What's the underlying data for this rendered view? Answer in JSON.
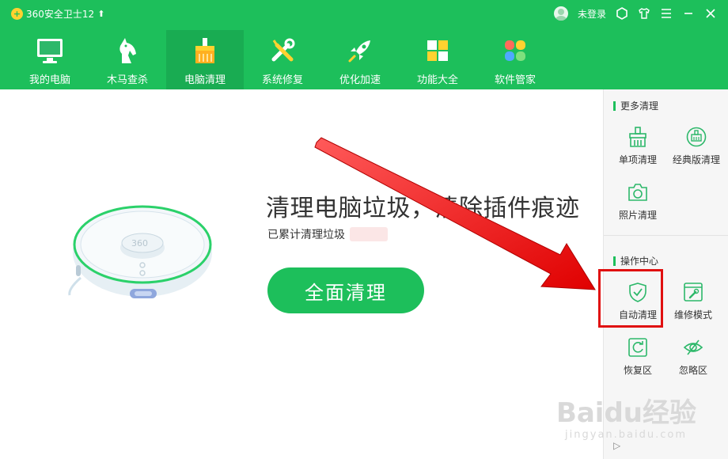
{
  "app": {
    "title": "360安全卫士12",
    "update_icon": "arrow-up-icon"
  },
  "account": {
    "login_label": "未登录"
  },
  "nav": {
    "items": [
      {
        "label": "我的电脑",
        "icon": "monitor-icon"
      },
      {
        "label": "木马查杀",
        "icon": "horse-icon"
      },
      {
        "label": "电脑清理",
        "icon": "broom-icon",
        "active": true
      },
      {
        "label": "系统修复",
        "icon": "wrench-screwdriver-icon"
      },
      {
        "label": "优化加速",
        "icon": "rocket-icon"
      },
      {
        "label": "功能大全",
        "icon": "grid-apps-icon"
      },
      {
        "label": "软件管家",
        "icon": "software-flower-icon"
      }
    ]
  },
  "main": {
    "headline": "清理电脑垃圾，清除插件痕迹",
    "stat_label": "已累计清理垃圾",
    "clean_button": "全面清理"
  },
  "panel": {
    "more_title": "更多清理",
    "more_items": [
      {
        "label": "单项清理",
        "icon": "brush-icon"
      },
      {
        "label": "经典版清理",
        "icon": "broom-circle-icon"
      },
      {
        "label": "照片清理",
        "icon": "camera-icon"
      }
    ],
    "ops_title": "操作中心",
    "ops_items": [
      {
        "label": "自动清理",
        "icon": "shield-check-icon",
        "highlighted": true
      },
      {
        "label": "维修模式",
        "icon": "repair-window-icon"
      },
      {
        "label": "恢复区",
        "icon": "restore-icon"
      },
      {
        "label": "忽略区",
        "icon": "eye-slash-icon"
      }
    ],
    "collapse_icon": "chevron-right-icon"
  },
  "watermark": {
    "brand": "Baidu经验",
    "url": "jingyan.baidu.com"
  },
  "colors": {
    "brand_green": "#1dbf5b",
    "active_tab": "#19ac52",
    "highlight_red": "#e01010"
  }
}
